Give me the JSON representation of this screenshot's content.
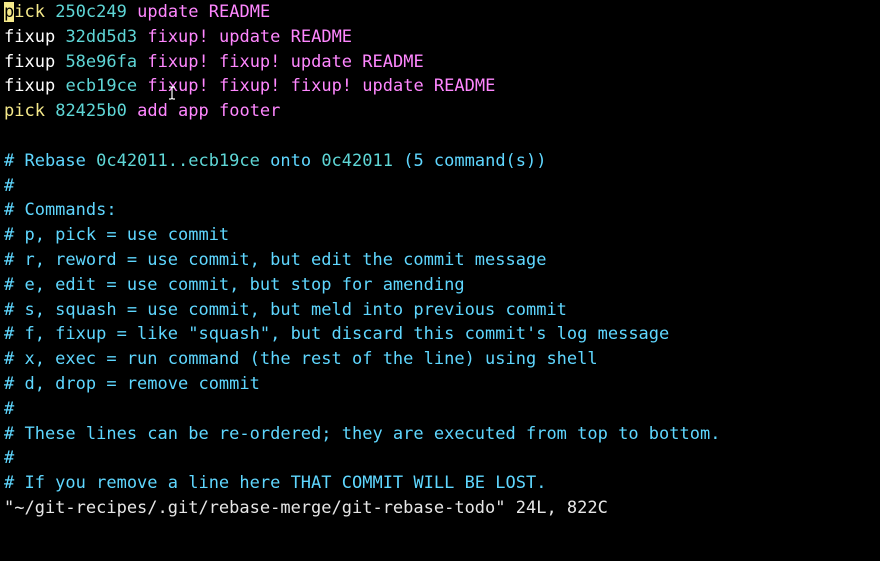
{
  "todo": [
    {
      "cursor": "p",
      "command_rest": "ick",
      "hash": "250c249",
      "message": "update README",
      "type": "pick"
    },
    {
      "cursor": "",
      "command_rest": "fixup",
      "hash": "32dd5d3",
      "message": "fixup! update README",
      "type": "fixup"
    },
    {
      "cursor": "",
      "command_rest": "fixup",
      "hash": "58e96fa",
      "message": "fixup! fixup! update README",
      "type": "fixup"
    },
    {
      "cursor": "",
      "command_rest": "fixup",
      "hash": "ecb19ce",
      "message": "fixup! fixup! fixup! update README",
      "type": "fixup"
    },
    {
      "cursor": "",
      "command_rest": "pick",
      "hash": "82425b0",
      "message": "add app footer",
      "type": "pick"
    }
  ],
  "rebase_header": {
    "prefix": "# Rebase ",
    "range": "0c42011..ecb19ce",
    "middle": " onto ",
    "onto": "0c42011",
    "suffix": " (5 command(s))"
  },
  "comments": [
    "#",
    "# Commands:",
    "# p, pick = use commit",
    "# r, reword = use commit, but edit the commit message",
    "# e, edit = use commit, but stop for amending",
    "# s, squash = use commit, but meld into previous commit",
    "# f, fixup = like \"squash\", but discard this commit's log message",
    "# x, exec = run command (the rest of the line) using shell",
    "# d, drop = remove commit",
    "#",
    "# These lines can be re-ordered; they are executed from top to bottom.",
    "#",
    "# If you remove a line here THAT COMMIT WILL BE LOST."
  ],
  "status_line": "\"~/git-recipes/.git/rebase-merge/git-rebase-todo\" 24L, 822C",
  "colors": {
    "background": "#000000",
    "pick": "#f5e98a",
    "hash": "#5fd7d7",
    "message": "#ff87ff",
    "comment": "#5fd7ff"
  },
  "icons": {
    "mouse_pointer": "i-beam-cursor-icon"
  }
}
